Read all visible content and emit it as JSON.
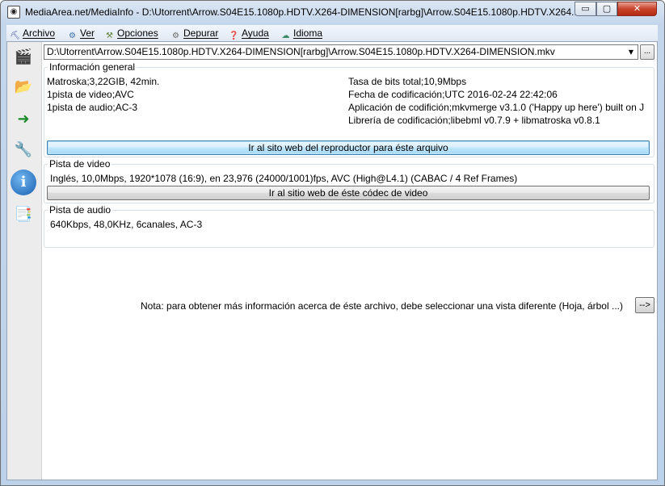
{
  "window": {
    "title": "MediaArea.net/MediaInfo - D:\\Utorrent\\Arrow.S04E15.1080p.HDTV.X264-DIMENSION[rarbg]\\Arrow.S04E15.1080p.HDTV.X264...",
    "app_icon": "speaker-icon",
    "minimize_label": "▭",
    "maximize_label": "▢",
    "close_label": "✕"
  },
  "menu": {
    "items": [
      {
        "label": "Archivo",
        "icon": "archivo-icon"
      },
      {
        "label": "Ver",
        "icon": "ver-icon"
      },
      {
        "label": "Opciones",
        "icon": "opciones-icon"
      },
      {
        "label": "Depurar",
        "icon": "depurar-icon"
      },
      {
        "label": "Ayuda",
        "icon": "ayuda-icon"
      },
      {
        "label": "Idioma",
        "icon": "idioma-icon"
      }
    ]
  },
  "sidebar": {
    "icons": [
      "open-file-icon",
      "open-folder-icon",
      "export-icon",
      "preferences-icon",
      "about-icon",
      "knowledge-base-icon"
    ]
  },
  "file": {
    "path": "D:\\Utorrent\\Arrow.S04E15.1080p.HDTV.X264-DIMENSION[rarbg]\\Arrow.S04E15.1080p.HDTV.X264-DIMENSION.mkv",
    "browse_label": "..."
  },
  "general": {
    "legend": "Información general",
    "left": [
      "Matroska;3,22GIB, 42min.",
      "1pista de video;AVC",
      "1pista de audio;AC-3"
    ],
    "right": [
      "Tasa de bits total;10,9Mbps",
      "Fecha de codificación;UTC 2016-02-24 22:42:06",
      "Aplicación de codifición;mkvmerge v3.1.0 ('Happy up here') built on J",
      "Librería de codificación;libebml v0.7.9 + libmatroska v0.8.1"
    ],
    "website_button": "Ir al sito web del reproductor para éste arquivo"
  },
  "video": {
    "legend": "Pista de video",
    "info": "Inglés, 10,0Mbps, 1920*1078 (16:9), en 23,976 (24000/1001)fps, AVC (High@L4.1) (CABAC / 4 Ref Frames)",
    "codec_button": "Ir al sitio web de éste códec de video"
  },
  "audio": {
    "legend": "Pista de audio",
    "info": "640Kbps, 48,0KHz, 6canales, AC-3"
  },
  "note": {
    "text": "Nota: para obtener más información acerca de éste archivo, debe seleccionar una vista diferente (Hoja, árbol ...)",
    "arrow_label": "-->"
  },
  "colors": {
    "title_bar": "#c4d6ec",
    "close_button": "#c7422b",
    "focus_button": "#bee6fd"
  }
}
